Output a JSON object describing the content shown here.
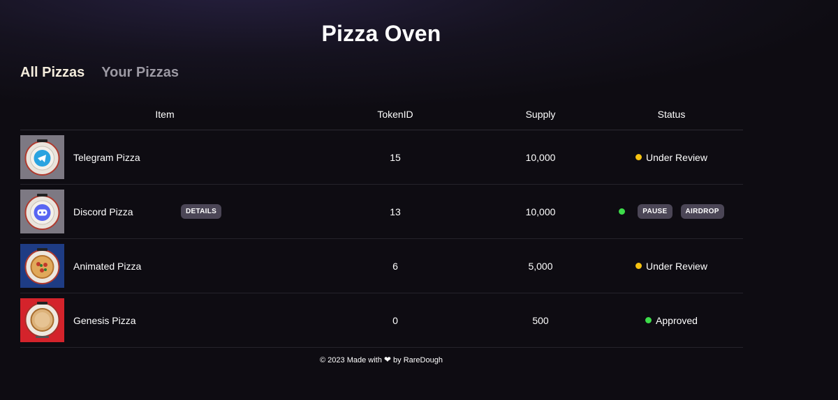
{
  "page": {
    "title": "Pizza Oven"
  },
  "tabs": [
    {
      "label": "All Pizzas",
      "active": true
    },
    {
      "label": "Your Pizzas",
      "active": false
    }
  ],
  "table": {
    "headers": {
      "item": "Item",
      "token": "TokenID",
      "supply": "Supply",
      "status": "Status"
    },
    "rows": [
      {
        "name": "Telegram Pizza",
        "token": "15",
        "supply": "10,000",
        "status": "Under Review",
        "status_color": "#f5c211"
      },
      {
        "name": "Discord Pizza",
        "details_label": "DETAILS",
        "token": "13",
        "supply": "10,000",
        "status_color": "#3ddc4a",
        "actions": [
          "PAUSE",
          "AIRDROP"
        ]
      },
      {
        "name": "Animated Pizza",
        "token": "6",
        "supply": "5,000",
        "status": "Under Review",
        "status_color": "#f5c211"
      },
      {
        "name": "Genesis Pizza",
        "token": "0",
        "supply": "500",
        "status": "Approved",
        "status_color": "#3ddc4a"
      }
    ]
  },
  "footer": {
    "prefix": "© 2023 Made with",
    "heart_icon": "heart-icon",
    "suffix": "by RareDough"
  }
}
